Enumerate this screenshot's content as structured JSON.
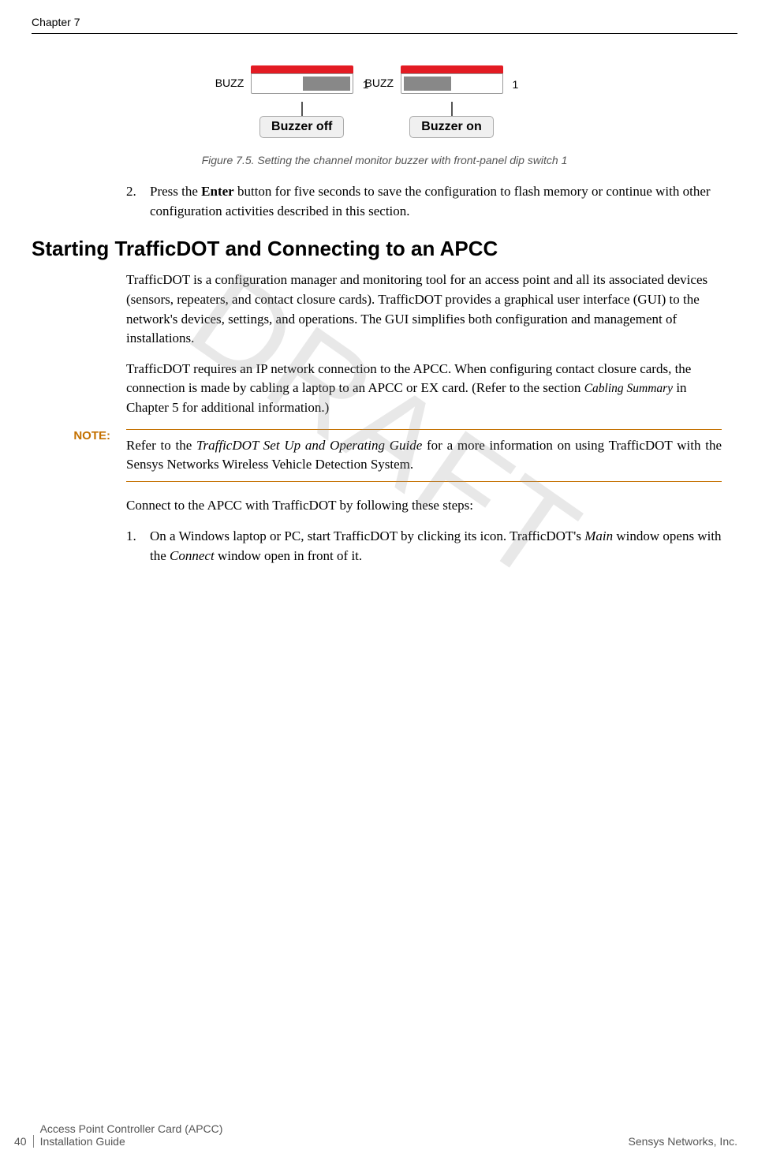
{
  "header": {
    "chapter": "Chapter 7"
  },
  "figure": {
    "buzz_label": "BUZZ",
    "num_label": "1",
    "callout_off": "Buzzer off",
    "callout_on": "Buzzer on",
    "caption": "Figure 7.5. Setting the channel monitor buzzer with front-panel dip switch 1"
  },
  "step2": {
    "num": "2.",
    "prefix": "Press the ",
    "bold": "Enter",
    "suffix": " button for five seconds to save the configuration to flash memory or continue with other configuration activities described in this section."
  },
  "heading": "Starting TrafficDOT and Connecting to an APCC",
  "para1": "TrafficDOT is a configuration manager and monitoring tool for an access point and all its associated devices (sensors, repeaters, and contact closure cards). TrafficDOT provides a graphical user interface (GUI) to the network's devices, settings, and operations. The GUI simplifies both configuration and management of installations.",
  "para2_parts": {
    "a": "TrafficDOT requires an IP network connection to the APCC. When configuring contact closure cards, the connection is made by cabling a laptop to an APCC or EX card. (Refer to the section ",
    "ref": "Cabling Summary",
    "b": " in Chapter 5 for additional information.)"
  },
  "note": {
    "label": "NOTE:",
    "text_a": "Refer to the ",
    "text_ref": "TrafficDOT Set Up and Operating Guide",
    "text_b": " for a more information on using TrafficDOT with the Sensys Networks Wireless Vehicle Detection System."
  },
  "para3": "Connect to the APCC with TrafficDOT by following these steps:",
  "step1b": {
    "num": "1.",
    "a": "On a Windows laptop or PC, start TrafficDOT by clicking its icon. TrafficDOT's ",
    "i1": "Main",
    "b": " window opens with the ",
    "i2": "Connect",
    "c": " window open in front of it."
  },
  "watermark": "DRAFT",
  "footer": {
    "page_number": "40",
    "title_line1": "Access Point Controller Card (APCC)",
    "title_line2": "Installation Guide",
    "company": "Sensys Networks, Inc."
  }
}
